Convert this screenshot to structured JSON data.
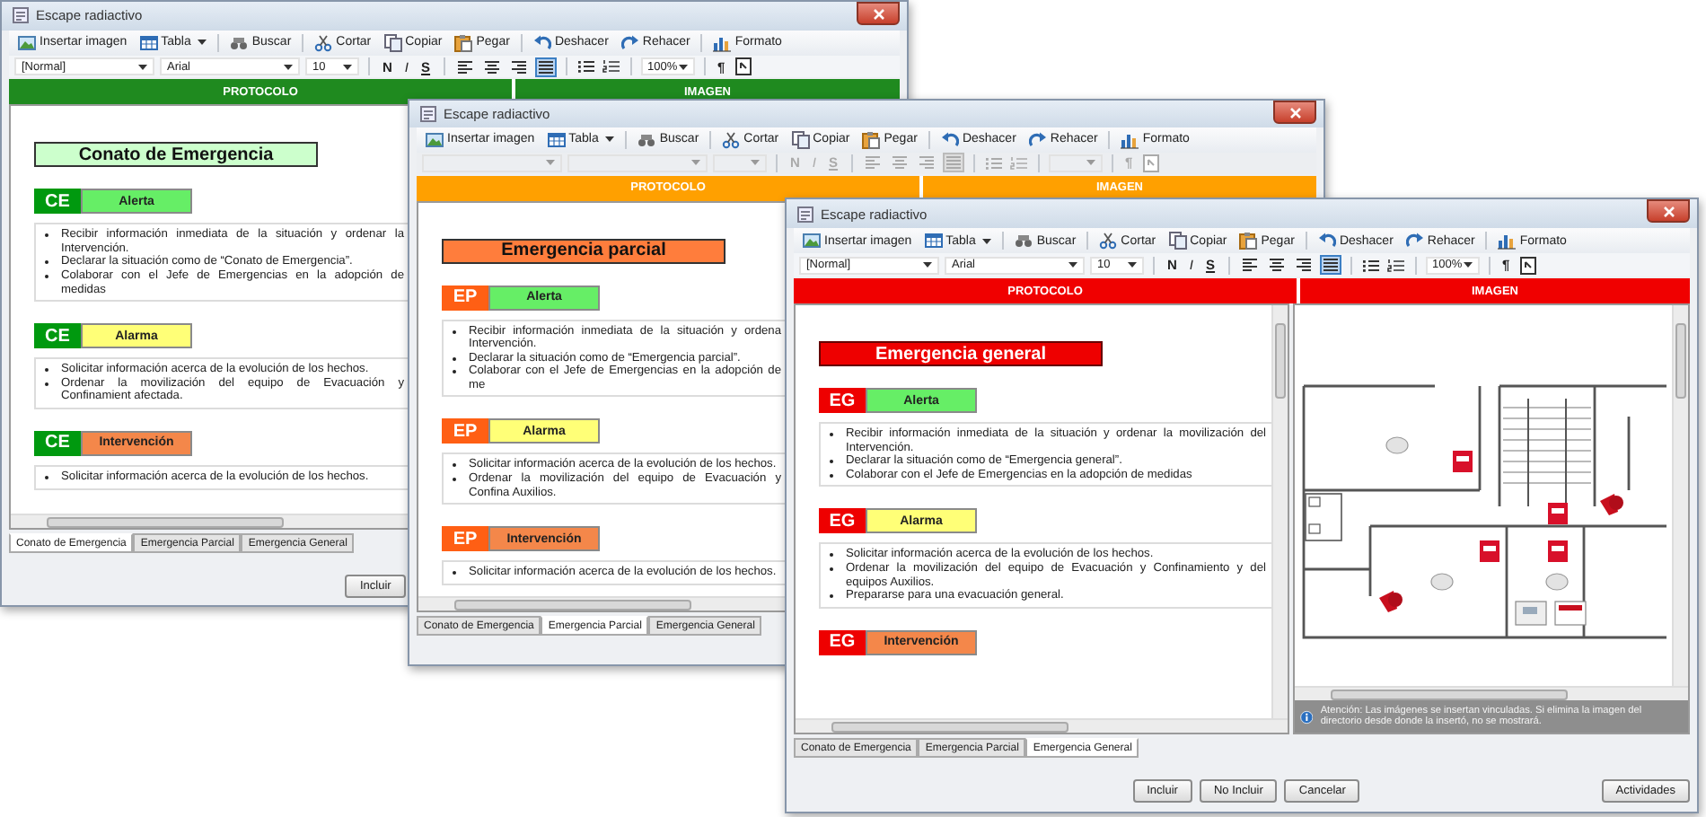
{
  "windows": [
    {
      "kind": "conato",
      "title": "Escape radiactivo",
      "toolbar": [
        {
          "label": "Insertar imagen",
          "dropdown": false
        },
        {
          "label": "Tabla",
          "dropdown": true
        },
        {
          "label": "Buscar",
          "dropdown": false
        },
        {
          "label": "Cortar",
          "dropdown": false
        },
        {
          "label": "Copiar",
          "dropdown": false
        },
        {
          "label": "Pegar",
          "dropdown": false
        },
        {
          "label": "Deshacer",
          "dropdown": false
        },
        {
          "label": "Rehacer",
          "dropdown": false
        },
        {
          "label": "Formato",
          "dropdown": false
        }
      ],
      "format": {
        "disabled": false,
        "style": "[Normal]",
        "font": "Arial",
        "size": "10",
        "style_buttons": [
          "N",
          "I",
          "S"
        ],
        "align_buttons": [
          {
            "selected": false
          },
          {
            "selected": false
          },
          {
            "selected": false
          },
          {
            "selected": true
          }
        ],
        "zoom": "100%",
        "paragraph_mark": "¶"
      },
      "columns": [
        "PROTOCOLO",
        "IMAGEN"
      ],
      "document": {
        "heading": "Conato de Emergencia",
        "sections": [
          {
            "code": "CE",
            "label": "Alerta",
            "kind": "alerta",
            "items": [
              "Recibir información inmediata de la situación y ordenar la Intervención.",
              "Declarar la situación como de “Conato de Emergencia”.",
              "Colaborar con el Jefe de Emergencias en la adopción de medidas"
            ]
          },
          {
            "code": "CE",
            "label": "Alarma",
            "kind": "alarma",
            "items": [
              "Solicitar información acerca de la evolución de los hechos.",
              "Ordenar la movilización del equipo de Evacuación y Confinamient afectada."
            ]
          },
          {
            "code": "CE",
            "label": "Intervención",
            "kind": "intervencion",
            "items": [
              "Solicitar información acerca de la evolución de los hechos."
            ]
          }
        ]
      },
      "tabs": [
        {
          "label": "Conato de Emergencia",
          "selected": true
        },
        {
          "label": "Emergencia Parcial",
          "selected": false
        },
        {
          "label": "Emergencia General",
          "selected": false
        }
      ],
      "buttons": [
        "Incluir"
      ]
    },
    {
      "kind": "parcial",
      "title": "Escape radiactivo",
      "toolbar": [
        {
          "label": "Insertar imagen",
          "dropdown": false
        },
        {
          "label": "Tabla",
          "dropdown": true
        },
        {
          "label": "Buscar",
          "dropdown": false
        },
        {
          "label": "Cortar",
          "dropdown": false
        },
        {
          "label": "Copiar",
          "dropdown": false
        },
        {
          "label": "Pegar",
          "dropdown": false
        },
        {
          "label": "Deshacer",
          "dropdown": false
        },
        {
          "label": "Rehacer",
          "dropdown": false
        },
        {
          "label": "Formato",
          "dropdown": false
        }
      ],
      "format": {
        "disabled": true,
        "style_buttons": [
          "N",
          "I",
          "S"
        ],
        "align_buttons": [
          {
            "selected": false
          },
          {
            "selected": false
          },
          {
            "selected": false
          },
          {
            "selected": true
          }
        ],
        "paragraph_mark": "¶"
      },
      "columns": [
        "PROTOCOLO",
        "IMAGEN"
      ],
      "document": {
        "heading": "Emergencia parcial",
        "sections": [
          {
            "code": "EP",
            "label": "Alerta",
            "kind": "alerta",
            "items": [
              "Recibir información inmediata de la situación y ordena Intervención.",
              "Declarar la situación como de “Emergencia parcial”.",
              "Colaborar con el Jefe de Emergencias en la adopción de me"
            ]
          },
          {
            "code": "EP",
            "label": "Alarma",
            "kind": "alarma",
            "items": [
              "Solicitar información acerca de la evolución de los hechos.",
              "Ordenar la movilización del equipo de Evacuación y Confina Auxilios."
            ]
          },
          {
            "code": "EP",
            "label": "Intervención",
            "kind": "intervencion",
            "items": [
              "Solicitar información acerca de la evolución de los hechos."
            ]
          }
        ]
      },
      "tabs": [
        {
          "label": "Conato de Emergencia",
          "selected": false
        },
        {
          "label": "Emergencia Parcial",
          "selected": true
        },
        {
          "label": "Emergencia General",
          "selected": false
        }
      ]
    },
    {
      "kind": "general",
      "title": "Escape radiactivo",
      "toolbar": [
        {
          "label": "Insertar imagen",
          "dropdown": false
        },
        {
          "label": "Tabla",
          "dropdown": true
        },
        {
          "label": "Buscar",
          "dropdown": false
        },
        {
          "label": "Cortar",
          "dropdown": false
        },
        {
          "label": "Copiar",
          "dropdown": false
        },
        {
          "label": "Pegar",
          "dropdown": false
        },
        {
          "label": "Deshacer",
          "dropdown": false
        },
        {
          "label": "Rehacer",
          "dropdown": false
        },
        {
          "label": "Formato",
          "dropdown": false
        }
      ],
      "format": {
        "disabled": false,
        "style": "[Normal]",
        "font": "Arial",
        "size": "10",
        "style_buttons": [
          "N",
          "I",
          "S"
        ],
        "align_buttons": [
          {
            "selected": false
          },
          {
            "selected": false
          },
          {
            "selected": false
          },
          {
            "selected": true
          }
        ],
        "zoom": "100%",
        "paragraph_mark": "¶"
      },
      "columns": [
        "PROTOCOLO",
        "IMAGEN"
      ],
      "document": {
        "heading": "Emergencia general",
        "sections": [
          {
            "code": "EG",
            "label": "Alerta",
            "kind": "alerta",
            "items": [
              "Recibir información inmediata de la situación y ordenar la movilización del Intervención.",
              "Declarar la situación como de “Emergencia general”.",
              "Colaborar con el Jefe de Emergencias en la adopción de medidas"
            ]
          },
          {
            "code": "EG",
            "label": "Alarma",
            "kind": "alarma",
            "items": [
              "Solicitar información acerca de la evolución de los hechos.",
              "Ordenar la movilización del equipo de Evacuación y Confinamiento y del equipos Auxilios.",
              "Prepararse para una evacuación general."
            ]
          },
          {
            "code": "EG",
            "label": "Intervención",
            "kind": "intervencion"
          }
        ]
      },
      "image": {
        "note": "Atención: Las imágenes se insertan vinculadas. Si elimina la imagen del directorio desde donde la insertó, no se mostrará."
      },
      "tabs": [
        {
          "label": "Conato de Emergencia",
          "selected": false
        },
        {
          "label": "Emergencia Parcial",
          "selected": false
        },
        {
          "label": "Emergencia General",
          "selected": true
        }
      ],
      "buttons": [
        "Incluir",
        "No Incluir",
        "Cancelar"
      ],
      "side_button": "Actividades"
    }
  ]
}
